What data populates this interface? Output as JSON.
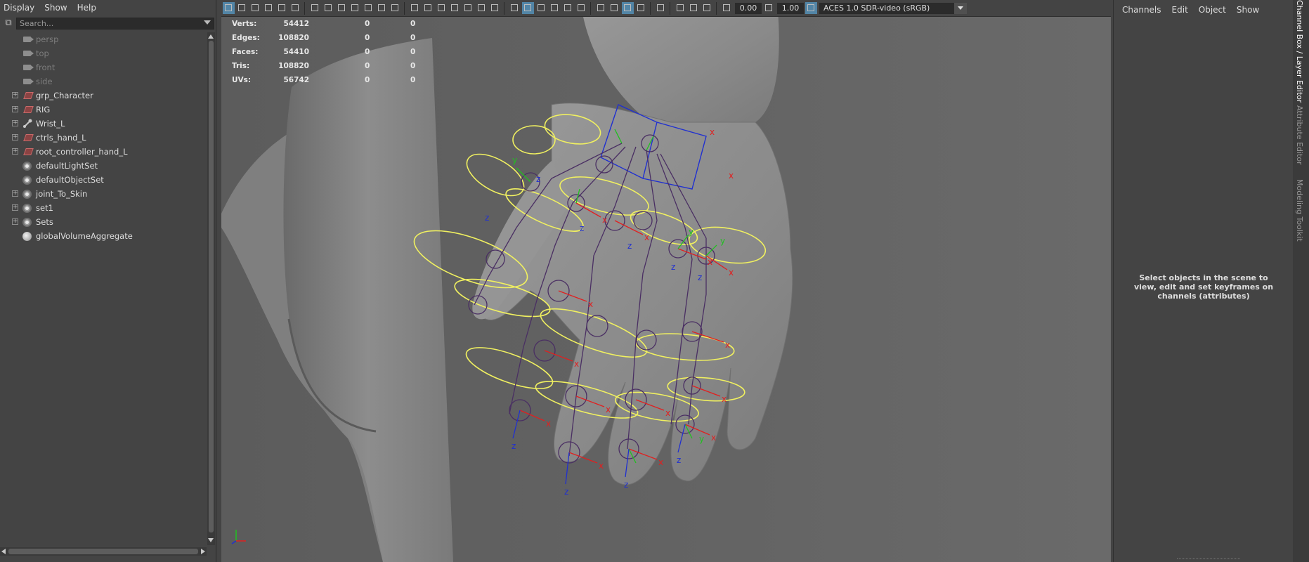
{
  "outliner": {
    "menu": [
      "Display",
      "Show",
      "Help"
    ],
    "search_placeholder": "Search...",
    "items": [
      {
        "label": "persp",
        "icon": "camera-icon",
        "dim": true,
        "expandable": false
      },
      {
        "label": "top",
        "icon": "camera-icon",
        "dim": true,
        "expandable": false
      },
      {
        "label": "front",
        "icon": "camera-icon",
        "dim": true,
        "expandable": false
      },
      {
        "label": "side",
        "icon": "camera-icon",
        "dim": true,
        "expandable": false
      },
      {
        "label": "grp_Character",
        "icon": "group-icon",
        "dim": false,
        "expandable": true
      },
      {
        "label": "RIG",
        "icon": "group-icon",
        "dim": false,
        "expandable": true
      },
      {
        "label": "Wrist_L",
        "icon": "joint-icon",
        "dim": false,
        "expandable": true
      },
      {
        "label": "ctrls_hand_L",
        "icon": "group-icon",
        "dim": false,
        "expandable": true
      },
      {
        "label": "root_controller_hand_L",
        "icon": "group-icon",
        "dim": false,
        "expandable": true
      },
      {
        "label": "defaultLightSet",
        "icon": "set-icon",
        "dim": false,
        "expandable": false
      },
      {
        "label": "defaultObjectSet",
        "icon": "set-icon",
        "dim": false,
        "expandable": false
      },
      {
        "label": "joint_To_Skin",
        "icon": "set-icon",
        "dim": false,
        "expandable": true
      },
      {
        "label": "set1",
        "icon": "set-icon",
        "dim": false,
        "expandable": true
      },
      {
        "label": "Sets",
        "icon": "set-icon",
        "dim": false,
        "expandable": true
      },
      {
        "label": "globalVolumeAggregate",
        "icon": "volume-icon",
        "dim": false,
        "expandable": false
      }
    ]
  },
  "viewport": {
    "fields": {
      "exposure": "0.00",
      "gamma": "1.00"
    },
    "color_space": "ACES 1.0 SDR-video (sRGB)",
    "hud": [
      {
        "label": "Verts:",
        "values": [
          "54412",
          "0",
          "0"
        ]
      },
      {
        "label": "Edges:",
        "values": [
          "108820",
          "0",
          "0"
        ]
      },
      {
        "label": "Faces:",
        "values": [
          "54410",
          "0",
          "0"
        ]
      },
      {
        "label": "Tris:",
        "values": [
          "108820",
          "0",
          "0"
        ]
      },
      {
        "label": "UVs:",
        "values": [
          "56742",
          "0",
          "0"
        ]
      }
    ],
    "colors": {
      "joint": "#4a2f63",
      "controller": "#f0f060",
      "axis_x": "#e02020",
      "axis_y": "#20c020",
      "axis_z": "#2030d0",
      "mesh": "#8a8a8a"
    }
  },
  "channelbox": {
    "menu": [
      "Channels",
      "Edit",
      "Object",
      "Show"
    ],
    "message": "Select objects in the scene to view, edit and set keyframes on channels (attributes)"
  },
  "side_tabs": [
    "Channel Box / Layer Editor",
    "Attribute Editor",
    "Modeling Toolkit"
  ]
}
